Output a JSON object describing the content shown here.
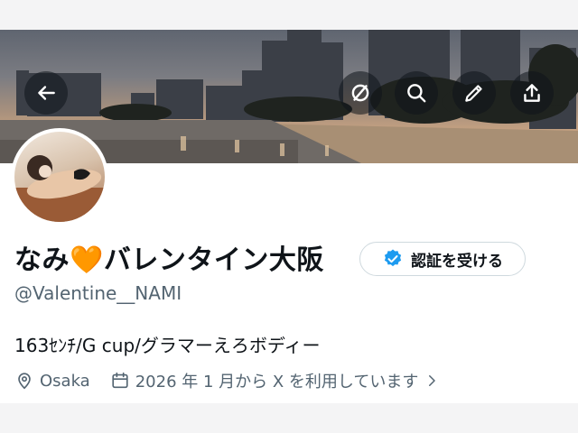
{
  "header": {
    "buttons": [
      {
        "name": "back",
        "icon": "arrow-left-icon"
      },
      {
        "name": "mute",
        "icon": "mute-icon"
      },
      {
        "name": "search",
        "icon": "search-icon"
      },
      {
        "name": "edit",
        "icon": "pencil-icon"
      },
      {
        "name": "share",
        "icon": "share-icon"
      }
    ]
  },
  "profile": {
    "display_name": "なみ🧡バレンタイン大阪",
    "handle": "@Valentine__NAMI",
    "bio": "163ｾﾝﾁ/G cup/グラマーえろボディー",
    "location": "Osaka",
    "joined": "2026 年 1 月から X を利用しています",
    "verify_button_label": "認証を受ける",
    "verify_icon": "verified-badge-icon"
  },
  "colors": {
    "verified_blue": "#1d9bf0",
    "secondary_text": "#536471",
    "text": "#0f1419",
    "border": "#cfd9de"
  }
}
